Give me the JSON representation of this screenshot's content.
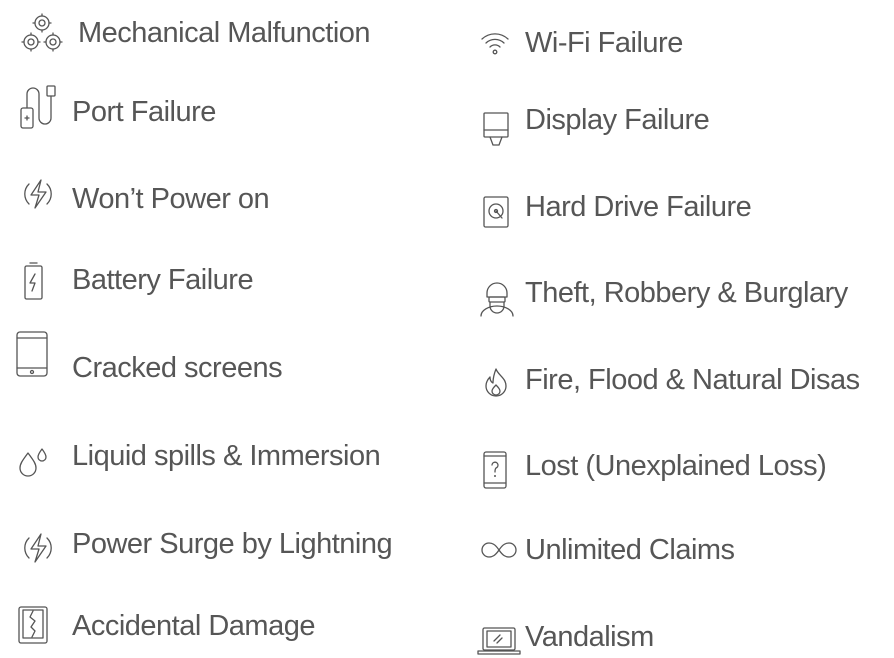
{
  "left_column": [
    {
      "label": "Mechanical Malfunction",
      "icon": "gears-icon"
    },
    {
      "label": "Port Failure",
      "icon": "cable-icon"
    },
    {
      "label": "Won’t Power on",
      "icon": "power-bolt-icon"
    },
    {
      "label": "Battery Failure",
      "icon": "battery-icon"
    },
    {
      "label": "Cracked screens",
      "icon": "tablet-icon"
    },
    {
      "label": "Liquid spills & Immersion",
      "icon": "droplets-icon"
    },
    {
      "label": "Power Surge by Lightning",
      "icon": "power-bolt-icon"
    },
    {
      "label": "Accidental Damage",
      "icon": "cracked-phone-icon"
    }
  ],
  "right_column": [
    {
      "label": "Wi-Fi Failure",
      "icon": "wifi-icon"
    },
    {
      "label": "Display Failure",
      "icon": "display-icon"
    },
    {
      "label": "Hard Drive Failure",
      "icon": "hard-drive-icon"
    },
    {
      "label": "Theft, Robbery & Burglary",
      "icon": "thief-icon"
    },
    {
      "label": "Fire, Flood & Natural Disas",
      "icon": "flame-icon"
    },
    {
      "label": "Lost (Unexplained Loss)",
      "icon": "question-phone-icon"
    },
    {
      "label": "Unlimited Claims",
      "icon": "infinity-icon"
    },
    {
      "label": "Vandalism",
      "icon": "laptop-icon"
    }
  ]
}
